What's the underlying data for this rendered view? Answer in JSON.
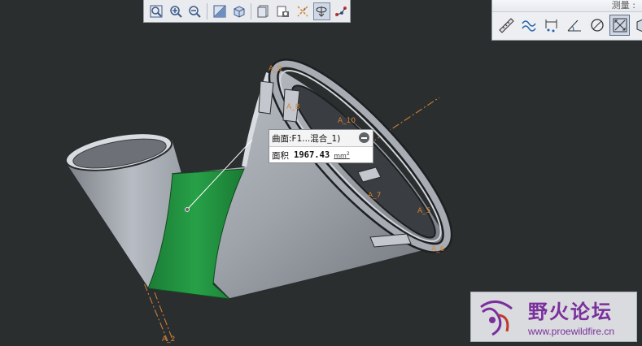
{
  "measure_panel": {
    "title": "测量 : "
  },
  "callout": {
    "surface_label": "曲面:F1...混合_1)",
    "area_label": "面积",
    "area_value": "1967.43",
    "area_unit": "mm",
    "area_unit_power": "2"
  },
  "datums": {
    "a2": "A_2",
    "a5": "A_5",
    "a6": "A_6",
    "a7": "A_7",
    "a8": "A_8",
    "a9": "A_9",
    "a10": "A_10"
  },
  "watermark": {
    "title": "野火论坛",
    "url": "www.proewildfire.cn"
  },
  "colors": {
    "background": "#2b2e2f",
    "selected_surface": "#1f8c3c",
    "datum_axis": "#d78535",
    "watermark_text": "#7a2f9c"
  }
}
